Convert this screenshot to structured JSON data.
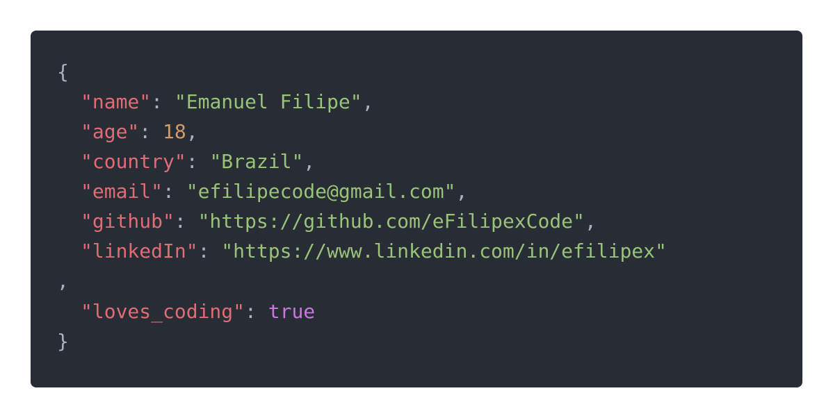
{
  "code": {
    "open_brace": "{",
    "close_brace": "}",
    "lone_comma": ",",
    "entries": [
      {
        "key": "\"name\"",
        "value": "\"Emanuel Filipe\"",
        "sep": ": ",
        "comma": ","
      },
      {
        "key": "\"age\"",
        "value": "18",
        "sep": ": ",
        "comma": ","
      },
      {
        "key": "\"country\"",
        "value": "\"Brazil\"",
        "sep": ": ",
        "comma": ","
      },
      {
        "key": "\"email\"",
        "value": "\"efilipecode@gmail.com\"",
        "sep": ": ",
        "comma": ","
      },
      {
        "key": "\"github\"",
        "value": "\"https://github.com/eFilipexCode\"",
        "sep": ": ",
        "comma": ","
      },
      {
        "key": "\"linkedIn\"",
        "value": "\"https://www.linkedin.com/in/efilipex\"",
        "sep": ": ",
        "comma": ""
      },
      {
        "key": "\"loves_coding\"",
        "value": "true",
        "sep": ": ",
        "comma": ""
      }
    ]
  },
  "colors": {
    "background": "#282c34",
    "punctuation": "#abb2bf",
    "key": "#e06c75",
    "string": "#98c379",
    "number": "#d19a66",
    "boolean": "#c678dd"
  }
}
